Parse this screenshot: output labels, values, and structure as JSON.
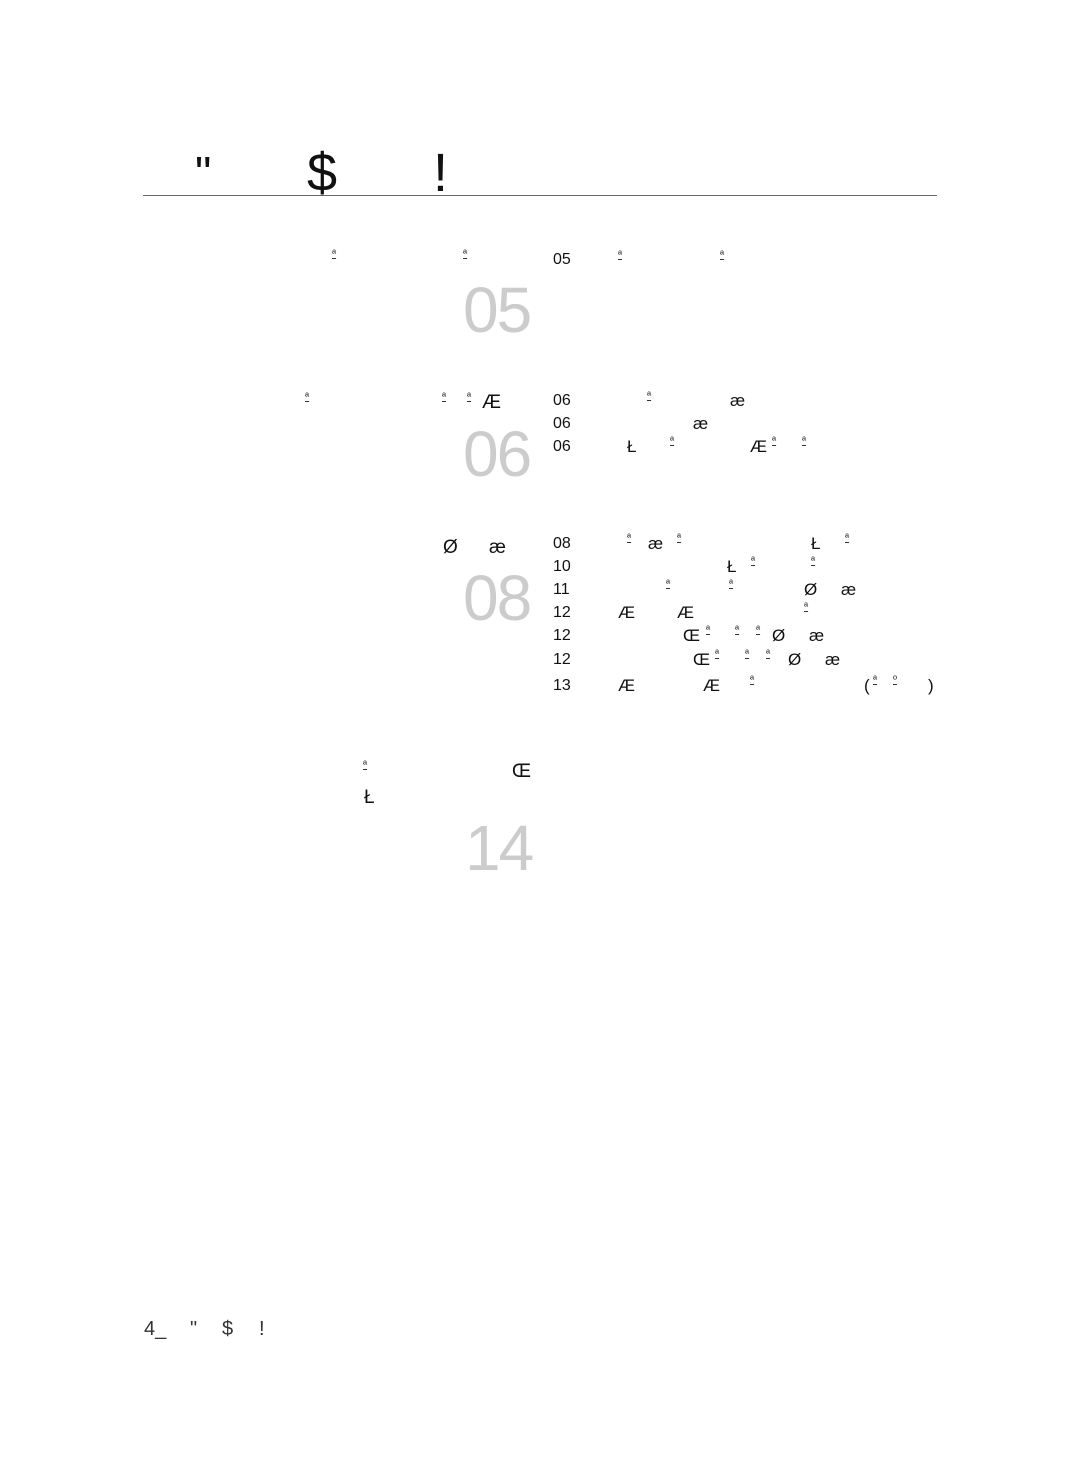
{
  "header": {
    "title_glyphs": [
      "\"",
      "$",
      "!"
    ]
  },
  "sections": [
    {
      "heading_glyphs": [
        "ª",
        "ª"
      ],
      "page": "05",
      "entries": [
        {
          "page": "05",
          "glyphs": [
            "ª",
            "ª"
          ]
        }
      ]
    },
    {
      "heading_glyphs": [
        "ª",
        "ª",
        "ª",
        "Æ"
      ],
      "page": "06",
      "entries": [
        {
          "page": "06",
          "glyphs": [
            "ª",
            "æ"
          ]
        },
        {
          "page": "06",
          "glyphs": [
            "æ"
          ]
        },
        {
          "page": "06",
          "glyphs": [
            "Ł",
            "ª",
            "Æ",
            "ª",
            "ª"
          ]
        }
      ]
    },
    {
      "heading_glyphs": [
        "Ø",
        "æ"
      ],
      "page": "08",
      "entries": [
        {
          "page": "08",
          "glyphs": [
            "ª",
            "æ",
            "ª",
            "Ł",
            "ª"
          ]
        },
        {
          "page": "10",
          "glyphs": [
            "Ł",
            "ª",
            "ª"
          ]
        },
        {
          "page": "11",
          "glyphs": [
            "ª",
            "ª",
            "Ø",
            "æ"
          ]
        },
        {
          "page": "12",
          "glyphs": [
            "Æ",
            "Æ",
            "ª"
          ]
        },
        {
          "page": "12",
          "glyphs": [
            "Œ",
            "ª",
            "ª",
            "ª",
            "Ø",
            "æ"
          ]
        },
        {
          "page": "12",
          "glyphs": [
            "Œ",
            "ª",
            "ª",
            "ª",
            "Ø",
            "æ"
          ]
        },
        {
          "page": "13",
          "glyphs": [
            "Æ",
            "Æ",
            "ª",
            "(",
            "ª",
            "º",
            ")"
          ]
        }
      ]
    },
    {
      "heading_glyphs": [
        "ª",
        "Œ",
        "Ł"
      ],
      "page": "14",
      "entries": []
    }
  ],
  "footer": {
    "page_label": "4_",
    "glyphs": [
      "\"",
      "$",
      "!"
    ]
  }
}
